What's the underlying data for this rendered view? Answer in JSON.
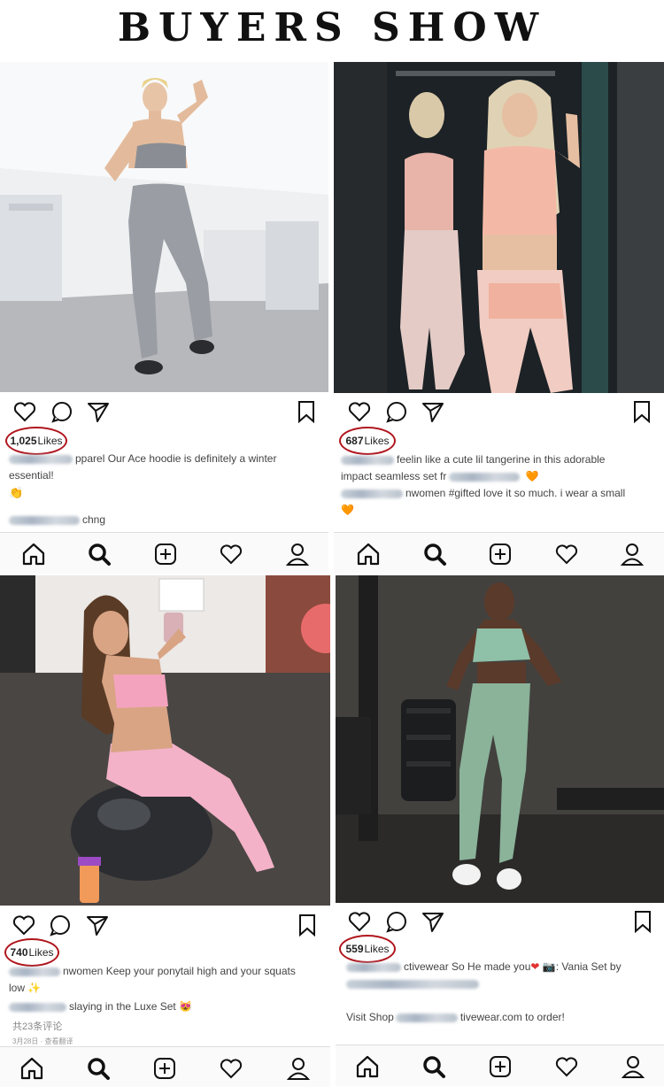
{
  "banner": {
    "title": "BUYERS SHOW"
  },
  "posts": [
    {
      "likes_count": "1,025",
      "likes_label": "Likes",
      "caption_line1": "pparel Our Ace hoodie is definitely a winter essential!",
      "caption_line2": "chng"
    },
    {
      "likes_count": "687",
      "likes_label": "Likes",
      "caption_line1": "feelin like a cute lil tangerine in this adorable",
      "caption_line2": "impact seamless set fr",
      "caption_line3": "nwomen #gifted love it so much. i wear a small"
    },
    {
      "likes_count": "740",
      "likes_label": "Likes",
      "caption_line1": "nwomen Keep your ponytail high and your squats",
      "caption_line2": "low",
      "caption_line3": "slaying in the Luxe Set",
      "comments": "共23条评论",
      "date": "3月28日 · 查看翻译"
    },
    {
      "likes_count": "559",
      "likes_label": "Likes",
      "caption_line1": "ctivewear So He made you",
      "caption_line1b": ": Vania Set by",
      "caption_line2": "Visit Shop",
      "caption_line2b": "tivewear.com to order!"
    }
  ],
  "icons": [
    "heart-icon",
    "comment-icon",
    "send-icon",
    "bookmark-icon",
    "home-icon",
    "search-icon",
    "add-post-icon",
    "activity-heart-icon",
    "profile-icon"
  ],
  "colors": {
    "likes_ring": "#b0151d",
    "background": "#ffffff"
  }
}
